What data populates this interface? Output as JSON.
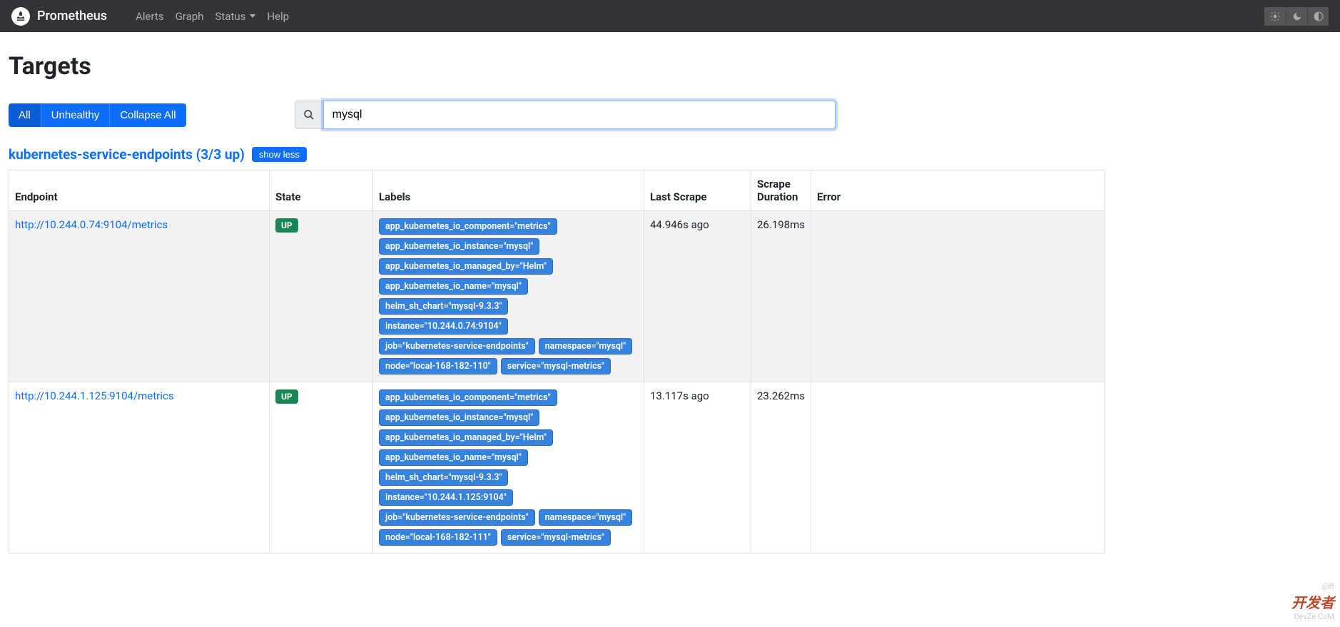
{
  "navbar": {
    "brand": "Prometheus",
    "items": [
      {
        "label": "Alerts",
        "dropdown": false
      },
      {
        "label": "Graph",
        "dropdown": false
      },
      {
        "label": "Status",
        "dropdown": true
      },
      {
        "label": "Help",
        "dropdown": false
      }
    ]
  },
  "page": {
    "title": "Targets"
  },
  "filters": {
    "all": "All",
    "unhealthy": "Unhealthy",
    "collapse": "Collapse All"
  },
  "search": {
    "value": "mysql"
  },
  "group": {
    "title": "kubernetes-service-endpoints (3/3 up)",
    "show_less": "show less"
  },
  "table": {
    "headers": {
      "endpoint": "Endpoint",
      "state": "State",
      "labels": "Labels",
      "last_scrape": "Last Scrape",
      "scrape_duration": "Scrape Duration",
      "error": "Error"
    },
    "rows": [
      {
        "endpoint": "http://10.244.0.74:9104/metrics",
        "state": "UP",
        "last_scrape": "44.946s ago",
        "duration": "26.198ms",
        "error": "",
        "labels": [
          "app_kubernetes_io_component=\"metrics\"",
          "app_kubernetes_io_instance=\"mysql\"",
          "app_kubernetes_io_managed_by=\"Helm\"",
          "app_kubernetes_io_name=\"mysql\"",
          "helm_sh_chart=\"mysql-9.3.3\"",
          "instance=\"10.244.0.74:9104\"",
          "job=\"kubernetes-service-endpoints\"",
          "namespace=\"mysql\"",
          "node=\"local-168-182-110\"",
          "service=\"mysql-metrics\""
        ]
      },
      {
        "endpoint": "http://10.244.1.125:9104/metrics",
        "state": "UP",
        "last_scrape": "13.117s ago",
        "duration": "23.262ms",
        "error": "",
        "labels": [
          "app_kubernetes_io_component=\"metrics\"",
          "app_kubernetes_io_instance=\"mysql\"",
          "app_kubernetes_io_managed_by=\"Helm\"",
          "app_kubernetes_io_name=\"mysql\"",
          "helm_sh_chart=\"mysql-9.3.3\"",
          "instance=\"10.244.1.125:9104\"",
          "job=\"kubernetes-service-endpoints\"",
          "namespace=\"mysql\"",
          "node=\"local-168-182-111\"",
          "service=\"mysql-metrics\""
        ]
      }
    ]
  },
  "watermark": {
    "small": "@ff",
    "big": "开发者",
    "sub": "DevZe.CoM"
  }
}
